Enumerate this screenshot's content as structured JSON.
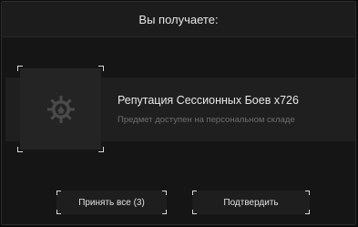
{
  "dialog": {
    "title": "Вы получаете:"
  },
  "reward": {
    "icon": "reputation-emblem-icon",
    "name": "Репутация Сессионных Боев x726",
    "subtitle": "Предмет доступен на персональном складе"
  },
  "buttons": {
    "accept_all": "Принять все (3)",
    "confirm": "Подтвердить"
  }
}
